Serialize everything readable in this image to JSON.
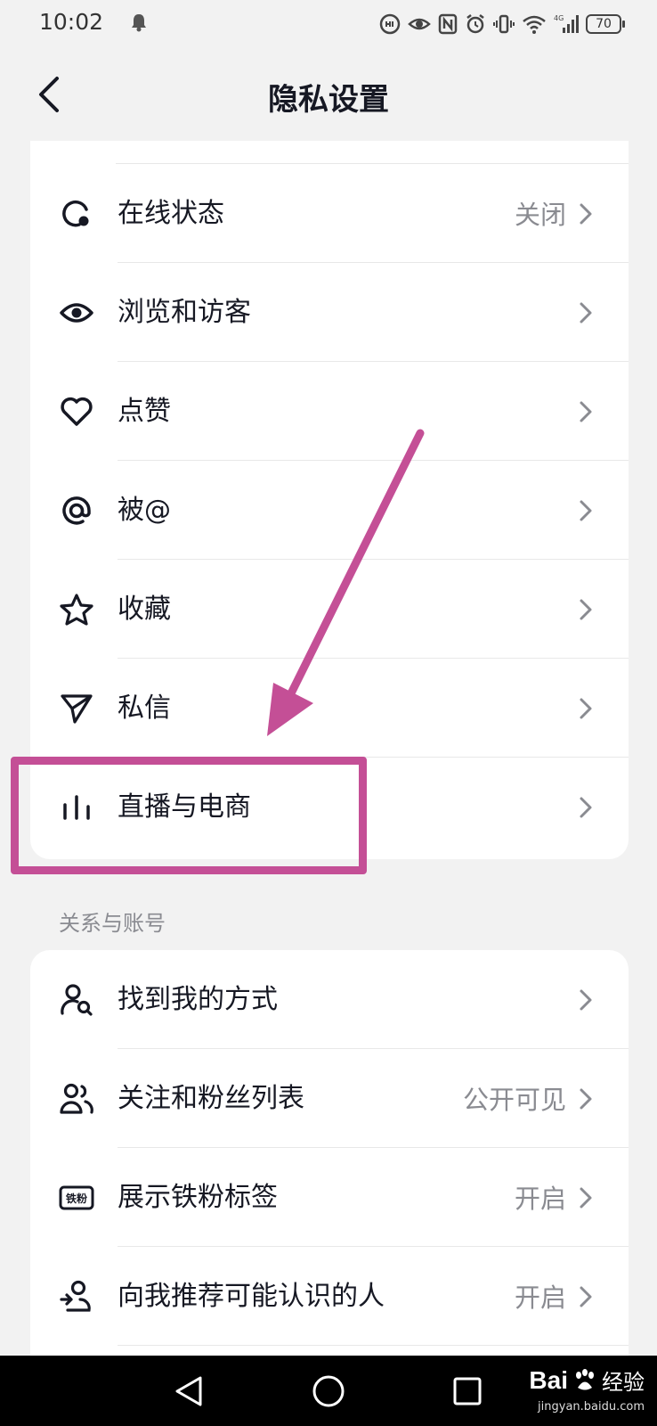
{
  "status_bar": {
    "time": "10:02",
    "battery": "70"
  },
  "header": {
    "title": "隐私设置"
  },
  "privacy_items": [
    {
      "label": "在线状态",
      "value": "关闭",
      "icon": "online-status-icon"
    },
    {
      "label": "浏览和访客",
      "value": "",
      "icon": "eye-icon"
    },
    {
      "label": "点赞",
      "value": "",
      "icon": "heart-icon"
    },
    {
      "label": "被@",
      "value": "",
      "icon": "at-icon"
    },
    {
      "label": "收藏",
      "value": "",
      "icon": "star-icon"
    },
    {
      "label": "私信",
      "value": "",
      "icon": "send-icon"
    },
    {
      "label": "直播与电商",
      "value": "",
      "icon": "live-bars-icon"
    }
  ],
  "section": {
    "title": "关系与账号"
  },
  "account_items": [
    {
      "label": "找到我的方式",
      "value": "",
      "icon": "find-user-icon"
    },
    {
      "label": "关注和粉丝列表",
      "value": "公开可见",
      "icon": "users-icon"
    },
    {
      "label": "展示铁粉标签",
      "value": "开启",
      "icon": "fan-badge-icon",
      "badge_text": "铁粉"
    },
    {
      "label": "向我推荐可能认识的人",
      "value": "开启",
      "icon": "recommend-user-icon"
    }
  ],
  "watermark": {
    "brand": "Bai",
    "brand_tail": "经验",
    "url": "jingyan.baidu.com"
  },
  "colors": {
    "annotation": "#c44f96",
    "text": "#161823",
    "secondary": "#8a8b91",
    "background": "#f2f2f2"
  }
}
